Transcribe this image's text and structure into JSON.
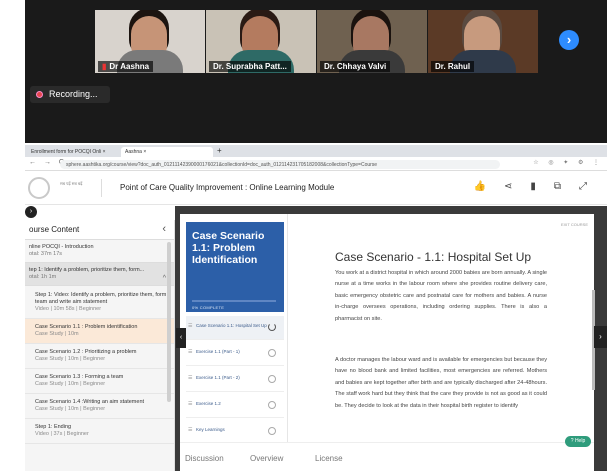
{
  "zoom": {
    "participants": [
      {
        "name": "Dr Aashna",
        "muted": true,
        "skin": "#c69477",
        "hair": "#1c1410",
        "shirt": "#7a7a7a",
        "bg": "#d8d3cd"
      },
      {
        "name": "Dr. Suprabha Patt...",
        "muted": false,
        "skin": "#b47b5f",
        "hair": "#2a1a14",
        "shirt": "#2e6a66",
        "bg": "#c9c2b6"
      },
      {
        "name": "Dr. Chhaya Valvi",
        "muted": false,
        "skin": "#a87862",
        "hair": "#1a120e",
        "shirt": "#3a3a3a",
        "bg": "#6f6150"
      },
      {
        "name": "Dr. Rahul",
        "muted": false,
        "skin": "#c79a7e",
        "hair": "#5a4a40",
        "shirt": "#2f3a4a",
        "bg": "#5b3a26"
      }
    ],
    "recording_label": "Recording...",
    "next_icon": "chevron-right-icon"
  },
  "browser": {
    "tabs": [
      "Enrollment form for POCQI Onli",
      "Aashna"
    ],
    "url": "sphere.aashtika.org/course/view?doc_auth_01211142390000176021&collectionId=doc_auth_012114231705182008&collectionType=Course"
  },
  "header": {
    "logo_text": "सब पढ़ें सब बढ़ें",
    "module_title": "Point of Care Quality Improvement : Online Learning Module",
    "icons": [
      "thumbs-up-icon",
      "share-icon",
      "bookmark-icon",
      "copy-icon",
      "fullscreen-icon"
    ]
  },
  "sidebar": {
    "title": "ourse Content",
    "sections": [
      {
        "title": "nline POCQI - Introduction",
        "sub": "otal: 37m 17s"
      },
      {
        "title": "tep 1: Identify a problem, prioritize them, form...",
        "sub": "otal: 1h 1m"
      }
    ],
    "items": [
      {
        "title": "Step 1: Video: Identify a problem, prioritize them, form team and write aim statement",
        "meta": "Video | 10m 58s | Beginner"
      },
      {
        "title": "Case Scenario 1.1 : Problem identification",
        "meta": "Case Study | 10m"
      },
      {
        "title": "Case Scenario 1.2 : Prioritizing a problem",
        "meta": "Case Study | 10m | Beginner"
      },
      {
        "title": "Case Scenario 1.3 : Forming a team",
        "meta": "Case Study | 10m | Beginner"
      },
      {
        "title": "Case Scenario 1.4 :Writing an aim statement",
        "meta": "Case Study | 10m | Beginner"
      },
      {
        "title": "Step 1: Ending",
        "meta": "Video | 37s | Beginner"
      }
    ]
  },
  "toc": {
    "hero_title": "Case Scenario 1.1: Problem Identification",
    "progress_label": "0% COMPLETE",
    "items": [
      "Case Scenario 1.1: Hospital Set Up",
      "Exercise 1.1 (Part - 1)",
      "Exercise 1.1 (Part - 2)",
      "Exercise 1.2",
      "Key Learnings"
    ]
  },
  "reading": {
    "corner_label": "EXIT COURSE",
    "title": "Case Scenario - 1.1: Hospital Set Up",
    "para1": "You work at a district hospital in which around 2000 babies are born annually. A single nurse at a time works in the labour room where she provides routine delivery care, basic emergency obstetric care and postnatal care for mothers and babies. A nurse in-charge oversees operations, including ordering supplies. There is also a pharmacist on site.",
    "para2": "A doctor manages the labour ward and is available for emergencies but because they have no blood bank and limited facilities, most emergencies are referred. Mothers and babies are kept together after birth and are typically discharged after 24-48hours. The staff work hard but they think that the care they provide is not as good as it could be. They decide to look at the data in their hospital birth register to identify"
  },
  "bottom_tabs": [
    "Discussion",
    "Overview",
    "License"
  ],
  "help_label": "Help"
}
